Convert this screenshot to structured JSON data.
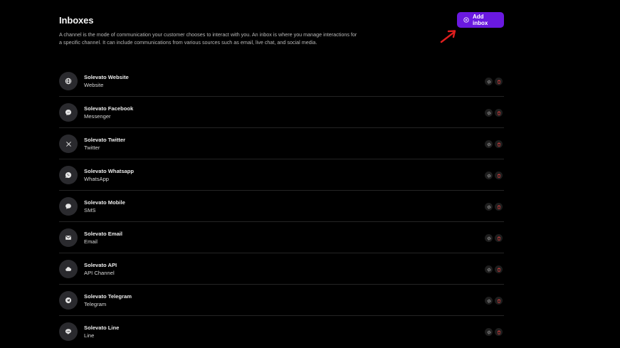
{
  "header": {
    "title": "Inboxes",
    "add_button_label": "Add inbox",
    "description": "A channel is the mode of communication your customer chooses to interact with you. An inbox is where you manage interactions for a specific channel. It can include communications from various sources such as email, live chat, and social media."
  },
  "colors": {
    "accent": "#6a19e0",
    "arrow": "#e01e1e",
    "delete": "#d94040"
  },
  "inboxes": [
    {
      "name": "Solevato Website",
      "type": "Website",
      "icon": "globe-icon"
    },
    {
      "name": "Solevato Facebook",
      "type": "Messenger",
      "icon": "messenger-icon"
    },
    {
      "name": "Solevato Twitter",
      "type": "Twitter",
      "icon": "x-twitter-icon"
    },
    {
      "name": "Solevato Whatsapp",
      "type": "WhatsApp",
      "icon": "whatsapp-icon"
    },
    {
      "name": "Solevato Mobile",
      "type": "SMS",
      "icon": "sms-bubble-icon"
    },
    {
      "name": "Solevato Email",
      "type": "Email",
      "icon": "mail-icon"
    },
    {
      "name": "Solevato API",
      "type": "API Channel",
      "icon": "cloud-icon"
    },
    {
      "name": "Solevato Telegram",
      "type": "Telegram",
      "icon": "telegram-icon"
    },
    {
      "name": "Solevato Line",
      "type": "Line",
      "icon": "line-icon"
    }
  ]
}
